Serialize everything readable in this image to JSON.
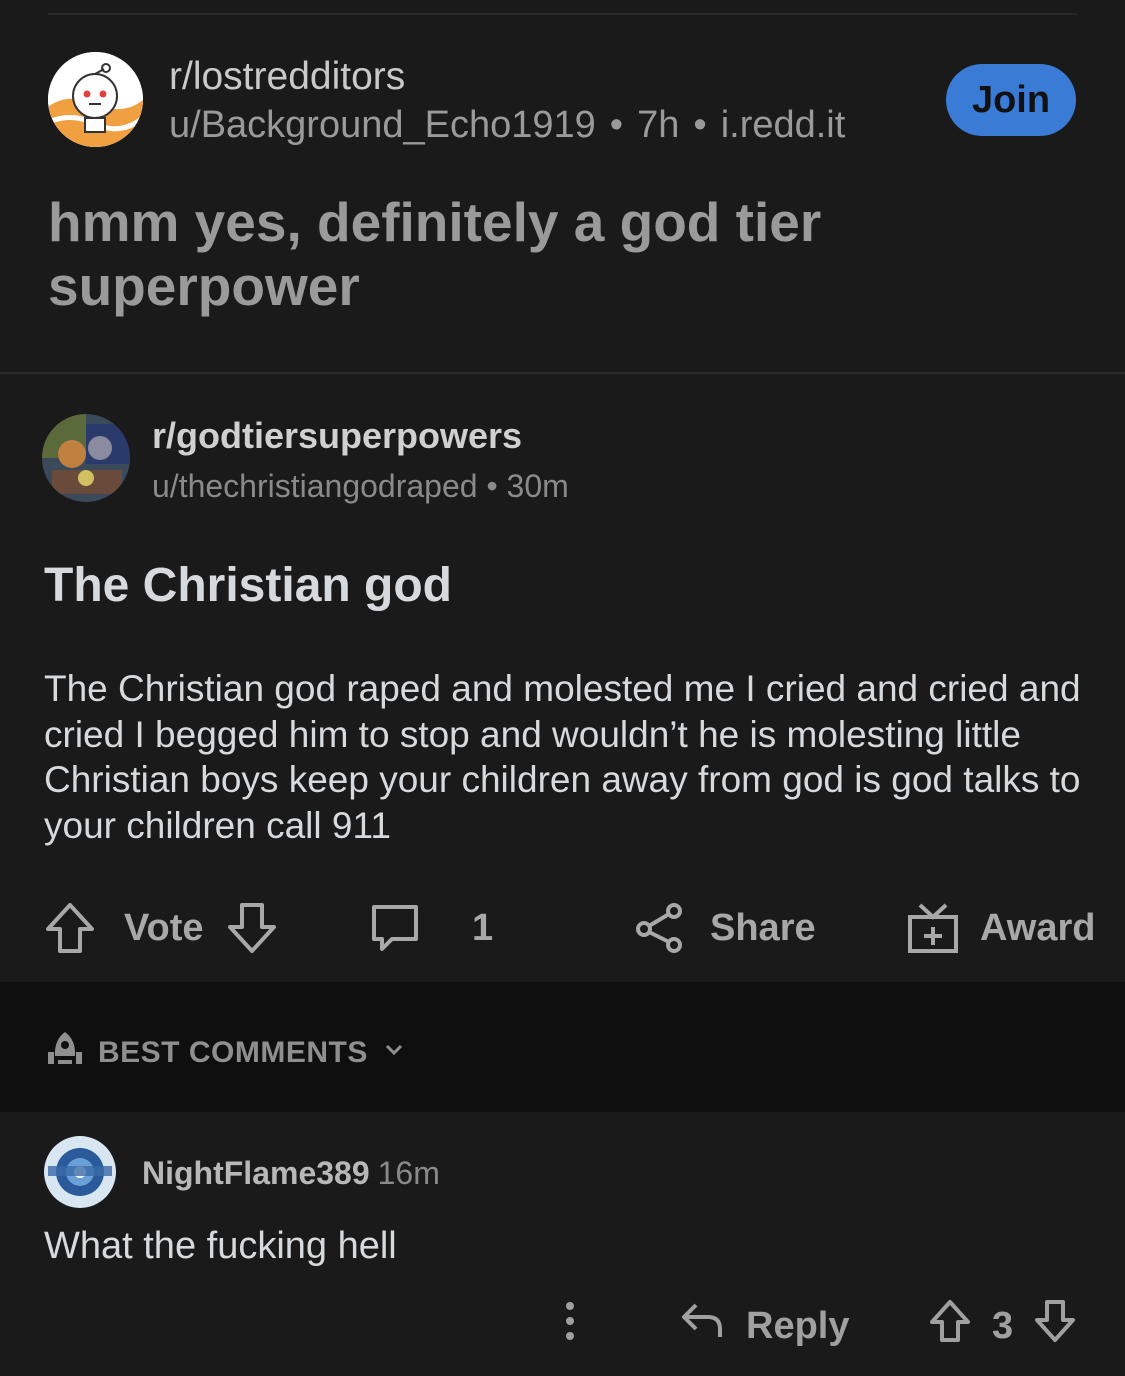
{
  "outer_post": {
    "subreddit": "r/lostredditors",
    "username": "u/Background_Echo1919",
    "time": "7h",
    "domain": "i.redd.it",
    "join_label": "Join",
    "title": "hmm yes, definitely a god tier superpower"
  },
  "screenshot": {
    "subreddit": "r/godtiersuperpowers",
    "username": "u/thechristiangodraped",
    "time": "30m",
    "title": "The Christian god",
    "body": "The Christian god raped and molested me I cried and cried and cried I begged him to stop and wouldn’t he is molesting little Christian boys keep your children away from god is god talks to your children call 911",
    "actions": {
      "vote_label": "Vote",
      "comment_count": "1",
      "share_label": "Share",
      "award_label": "Award"
    },
    "sort_label": "BEST COMMENTS",
    "comment": {
      "username": "NightFlame389",
      "time": "16m",
      "body": "What the fucking hell",
      "reply_label": "Reply",
      "score": "3"
    }
  },
  "colors": {
    "background": "#1a1a1b",
    "join_button": "#3a7bd5",
    "best_comments_band": "#0f0f10"
  },
  "icons": [
    "snoo-avatar-icon",
    "subreddit-avatar-icon",
    "upvote-icon",
    "downvote-icon",
    "comment-icon",
    "share-icon",
    "award-icon",
    "rocket-icon",
    "chevron-down-icon",
    "more-icon",
    "reply-icon"
  ]
}
